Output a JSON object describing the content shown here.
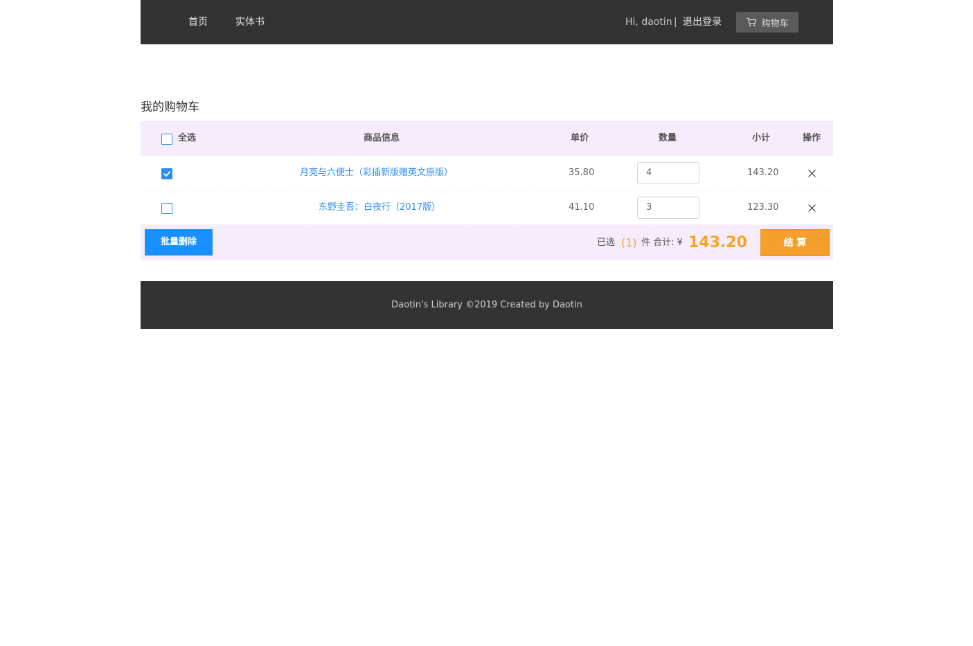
{
  "header": {
    "nav": [
      {
        "label": "首页"
      },
      {
        "label": "实体书"
      }
    ],
    "greeting": "Hi, daotin",
    "separator": "|",
    "logout": "退出登录",
    "cart_label": "购物车"
  },
  "page_title": "我的购物车",
  "table": {
    "select_all_label": "全选",
    "headers": {
      "product": "商品信息",
      "unit_price": "单价",
      "quantity": "数量",
      "subtotal": "小计",
      "action": "操作"
    },
    "rows": [
      {
        "checked": true,
        "title": "月亮与六便士（彩插新版赠英文原版）",
        "price": "35.80",
        "quantity": "4",
        "subtotal": "143.20",
        "delete": "X"
      },
      {
        "checked": false,
        "title": "东野圭吾：白夜行（2017版）",
        "price": "41.10",
        "quantity": "3",
        "subtotal": "123.30",
        "delete": "X"
      }
    ]
  },
  "summary": {
    "batch_delete": "批量删除",
    "selected_prefix": "已选",
    "selected_count": "(1)",
    "selected_suffix": "件 合计: ¥",
    "total": "143.20",
    "checkout": "结 算"
  },
  "footer": {
    "text": "Daotin's Library ©2019 Created by Daotin"
  },
  "colors": {
    "header_bg": "#333333",
    "table_head_bg": "#f7ecfb",
    "link": "#2d8cf0",
    "primary_button": "#1890ff",
    "accent": "#f5a623"
  }
}
